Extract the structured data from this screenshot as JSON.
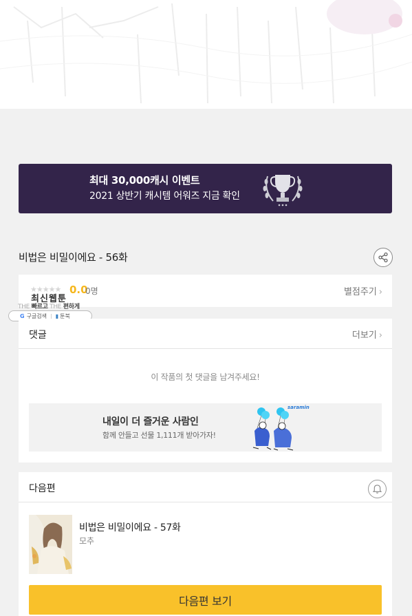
{
  "banner": {
    "title": "최대 30,000캐시 이벤트",
    "subtitle": "2021 상반기 캐시템 어워즈 지금 확인"
  },
  "episode": {
    "title": "비법은 비밀이에요 - 56화"
  },
  "rating": {
    "stars": "★★★★★",
    "score": "0.0",
    "count": "0명",
    "rate_label": "별점주기"
  },
  "promo_badge": {
    "title": "최신웹툰",
    "slogan_faint_1": "THE",
    "slogan_bold_1": "빠르고",
    "slogan_faint_2": "THE",
    "slogan_bold_2": "편하게",
    "pill_google_mark": "G",
    "pill_left": "구글검색",
    "pill_right": "툰북"
  },
  "comments": {
    "header": "댓글",
    "more_label": "더보기",
    "empty_message": "이 작품의 첫 댓글을 남겨주세요!",
    "ad": {
      "title": "내일이 더 즐거운 사람인",
      "subtitle": "함께 안들고 선물 1,111개 받아가자!",
      "brand": "saramin"
    }
  },
  "next_episode": {
    "header": "다음편",
    "title": "비법은 비밀이에요 - 57화",
    "author": "모추",
    "button_label": "다음편 보기"
  },
  "colors": {
    "banner_bg": "#33244a",
    "score": "#f6b71d",
    "next_button": "#f9c12a",
    "page_bg": "#f1f1f1"
  }
}
